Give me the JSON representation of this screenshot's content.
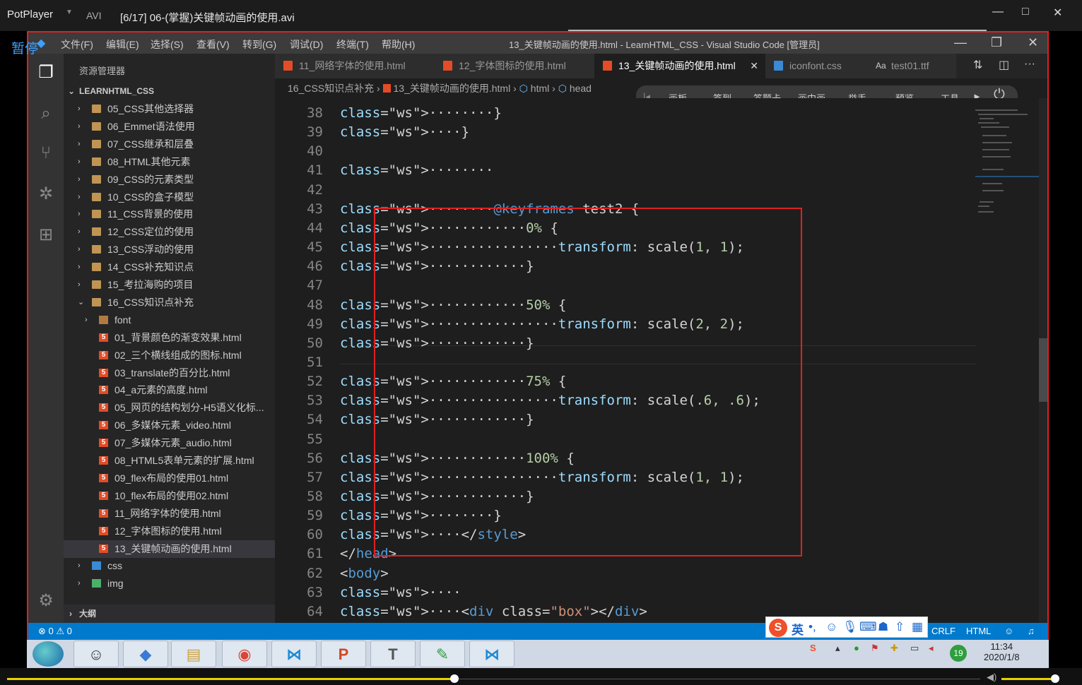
{
  "player": {
    "name": "PotPlayer",
    "format": "AVI",
    "file_title": "[6/17] 06-(掌握)关键帧动画的使用.avi",
    "pause_label": "暂停",
    "progress_fraction": 0.46,
    "volume_fraction": 0.95
  },
  "vscode": {
    "menu": [
      "文件(F)",
      "编辑(E)",
      "选择(S)",
      "查看(V)",
      "转到(G)",
      "调试(D)",
      "终端(T)",
      "帮助(H)"
    ],
    "window_title": "13_关键帧动画的使用.html - LearnHTML_CSS - Visual Studio Code [管理员]",
    "sidebar": {
      "header": "资源管理器",
      "project": "LEARNHTML_CSS",
      "outline": "大纲",
      "folders_top": [
        "05_CSS其他选择器",
        "06_Emmet语法使用",
        "07_CSS继承和层叠",
        "08_HTML其他元素",
        "09_CSS的元素类型",
        "10_CSS的盒子模型",
        "11_CSS背景的使用",
        "12_CSS定位的使用",
        "13_CSS浮动的使用",
        "14_CSS补充知识点",
        "15_考拉海购的项目",
        "16_CSS知识点补充"
      ],
      "subfolder": "font",
      "files": [
        "01_背景颜色的渐变效果.html",
        "02_三个横线组成的图标.html",
        "03_translate的百分比.html",
        "04_a元素的高度.html",
        "05_网页的结构划分-H5语义化标...",
        "06_多媒体元素_video.html",
        "07_多媒体元素_audio.html",
        "08_HTML5表单元素的扩展.html",
        "09_flex布局的使用01.html",
        "10_flex布局的使用02.html",
        "11_网络字体的使用.html",
        "12_字体图标的使用.html",
        "13_关键帧动画的使用.html"
      ],
      "folders_bottom": [
        "css",
        "img"
      ]
    },
    "tabs": [
      {
        "label": "11_网络字体的使用.html",
        "kind": "html"
      },
      {
        "label": "12_字体图标的使用.html",
        "kind": "html"
      },
      {
        "label": "13_关键帧动画的使用.html",
        "kind": "html",
        "active": true
      },
      {
        "label": "iconfont.css",
        "kind": "css"
      },
      {
        "label": "test01.ttf",
        "kind": "font"
      }
    ],
    "breadcrumb": [
      "16_CSS知识点补充",
      "13_关键帧动画的使用.html",
      "html",
      "head"
    ],
    "floating_toolbar": [
      "画板",
      "签到",
      "答题卡",
      "画中画",
      "举手",
      "预览",
      "工具"
    ],
    "code_lines": [
      {
        "n": "38",
        "t": "········}"
      },
      {
        "n": "39",
        "t": "····}"
      },
      {
        "n": "40",
        "t": ""
      },
      {
        "n": "41",
        "t": "········"
      },
      {
        "n": "42",
        "t": ""
      },
      {
        "n": "43",
        "t": "········@keyframes test2 {"
      },
      {
        "n": "44",
        "t": "············0% {"
      },
      {
        "n": "45",
        "t": "················transform: scale(1, 1);"
      },
      {
        "n": "46",
        "t": "············}"
      },
      {
        "n": "47",
        "t": ""
      },
      {
        "n": "48",
        "t": "············50% {"
      },
      {
        "n": "49",
        "t": "················transform: scale(2, 2);"
      },
      {
        "n": "50",
        "t": "············}"
      },
      {
        "n": "51",
        "t": ""
      },
      {
        "n": "52",
        "t": "············75% {"
      },
      {
        "n": "53",
        "t": "················transform: scale(.6, .6);"
      },
      {
        "n": "54",
        "t": "············}"
      },
      {
        "n": "55",
        "t": ""
      },
      {
        "n": "56",
        "t": "············100% {"
      },
      {
        "n": "57",
        "t": "················transform: scale(1, 1);"
      },
      {
        "n": "58",
        "t": "············}"
      },
      {
        "n": "59",
        "t": "········}"
      },
      {
        "n": "60",
        "t": "····</style>"
      },
      {
        "n": "61",
        "t": "</head>"
      },
      {
        "n": "62",
        "t": "<body>"
      },
      {
        "n": "63",
        "t": "····"
      },
      {
        "n": "64",
        "t": "····<div class=\"box\"></div>"
      }
    ],
    "status": {
      "problems": "⊗ 0 ⚠ 0",
      "eol": "CRLF",
      "language": "HTML"
    },
    "ime_label": "英"
  },
  "taskbar": {
    "time": "11:34",
    "date": "2020/1/8",
    "badge": "19"
  },
  "colors": {
    "accent": "#007acc",
    "highlight_box": "#e02020",
    "keyword": "#569cd6",
    "property": "#9cdcfe",
    "number": "#b5cea8",
    "string": "#ce9178"
  }
}
